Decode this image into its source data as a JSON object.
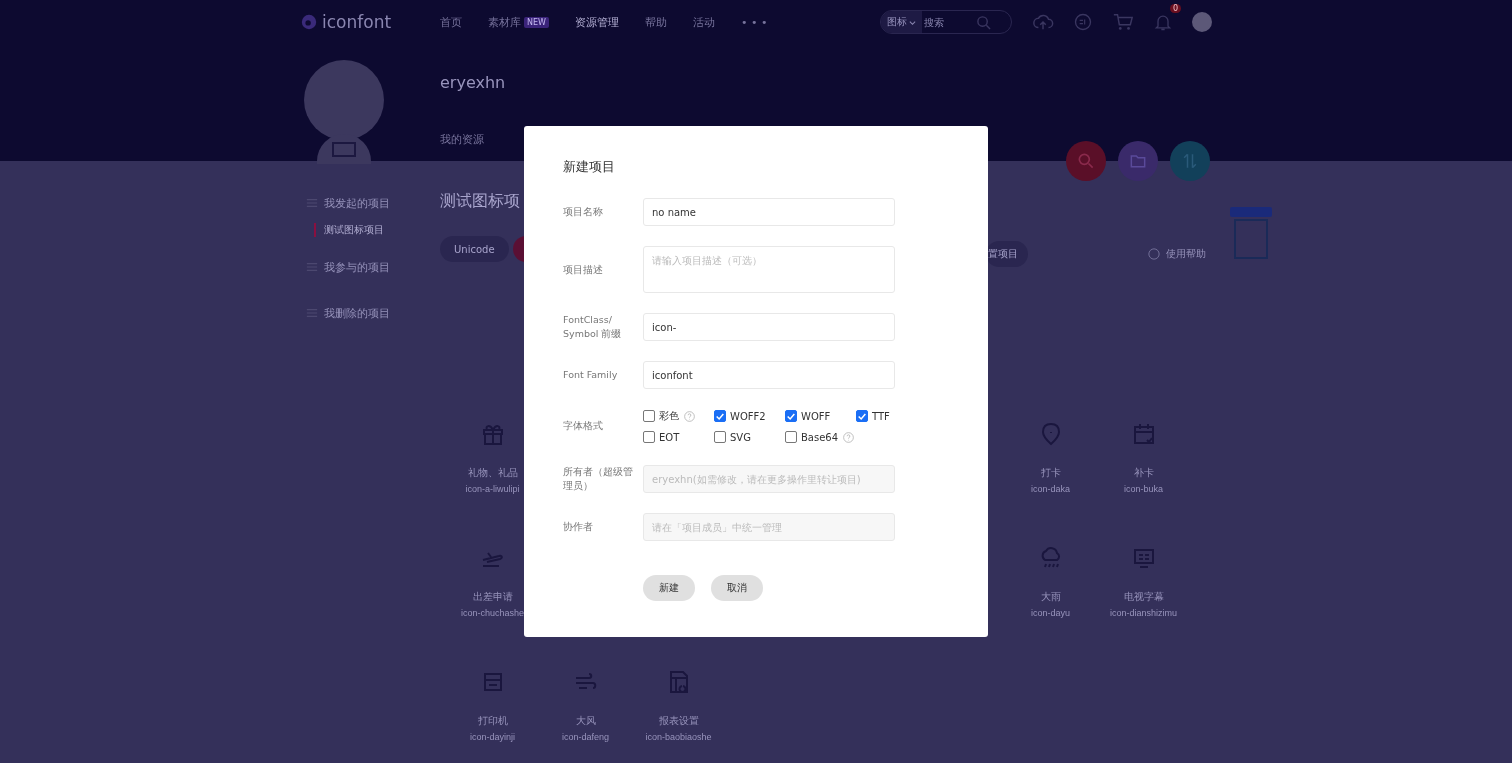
{
  "header": {
    "logo": "iconfont",
    "nav": [
      {
        "label": "首页",
        "selected": false
      },
      {
        "label": "素材库",
        "badge": "NEW",
        "selected": false
      },
      {
        "label": "资源管理",
        "selected": true
      },
      {
        "label": "帮助",
        "selected": false
      },
      {
        "label": "活动",
        "selected": false
      },
      {
        "label": "• • •",
        "selected": false
      }
    ],
    "search": {
      "scope": "图标",
      "placeholder": "搜索"
    },
    "notification_count": "0"
  },
  "profile": {
    "username": "eryexhn",
    "tabs": [
      {
        "label": "我的资源",
        "selected": false
      }
    ]
  },
  "sidebar": {
    "items": [
      {
        "label": "我发起的项目",
        "children": [
          {
            "label": "测试图标项目",
            "selected": true
          }
        ]
      },
      {
        "label": "我参与的项目"
      },
      {
        "label": "我删除的项目"
      }
    ]
  },
  "project": {
    "title": "测试图标项",
    "chips": [
      {
        "label": "Unicode",
        "selected": false
      }
    ],
    "right_chip": "置项目",
    "help_link": "使用帮助"
  },
  "icon_rows": [
    {
      "left": [
        {
          "name": "礼物、礼品",
          "code": "icon-a-liwulipi"
        }
      ],
      "right": [
        {
          "name": "打卡",
          "code": "icon-daka"
        },
        {
          "name": "补卡",
          "code": "icon-buka"
        }
      ]
    },
    {
      "left": [
        {
          "name": "出差申请",
          "code": "icon-chuchashe"
        }
      ],
      "right": [
        {
          "name": "大雨",
          "code": "icon-dayu"
        },
        {
          "name": "电视字幕",
          "code": "icon-dianshizimu"
        }
      ]
    },
    {
      "left": [
        {
          "name": "打印机",
          "code": "icon-dayinji"
        },
        {
          "name": "大风",
          "code": "icon-dafeng"
        },
        {
          "name": "报表设置",
          "code": "icon-baobiaoshe"
        }
      ],
      "right": []
    }
  ],
  "dialog": {
    "title": "新建项目",
    "fields": [
      {
        "kind": "input",
        "label": "项目名称",
        "value": "no name"
      },
      {
        "kind": "textarea",
        "label": "项目描述",
        "placeholder": "请输入项目描述（可选）"
      },
      {
        "kind": "input",
        "label": "FontClass/ Symbol 前缀",
        "value": "icon-"
      },
      {
        "kind": "input",
        "label": "Font Family",
        "value": "iconfont"
      },
      {
        "kind": "checkboxes",
        "label": "字体格式",
        "options": [
          {
            "label": "彩色",
            "checked": false,
            "help": true
          },
          {
            "label": "WOFF2",
            "checked": true,
            "help": false
          },
          {
            "label": "WOFF",
            "checked": true,
            "help": false
          },
          {
            "label": "TTF",
            "checked": true,
            "help": false
          },
          {
            "label": "EOT",
            "checked": false,
            "help": false
          },
          {
            "label": "SVG",
            "checked": false,
            "help": false
          },
          {
            "label": "Base64",
            "checked": false,
            "help": true
          }
        ]
      },
      {
        "kind": "disabled",
        "label": "所有者（超级管理员）",
        "placeholder": "eryexhn(如需修改，请在更多操作里转让项目)"
      },
      {
        "kind": "disabled",
        "label": "协作者",
        "placeholder": "请在「项目成员」中统一管理"
      }
    ],
    "buttons": [
      "新建",
      "取消"
    ]
  }
}
